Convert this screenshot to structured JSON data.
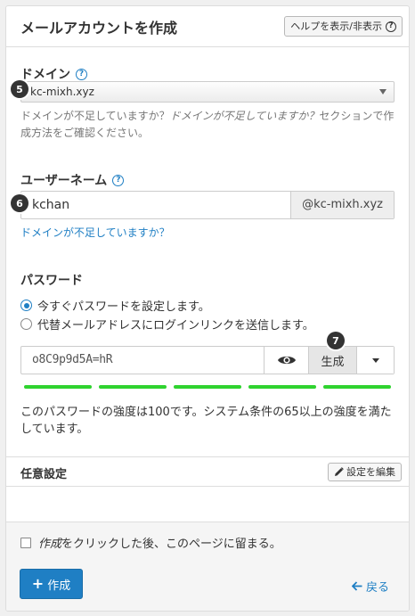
{
  "header": {
    "title": "メールアカウントを作成",
    "help_button": "ヘルプを表示/非表示"
  },
  "domain": {
    "label": "ドメイン",
    "selected": "kc-mixh.xyz",
    "help_part1": "ドメインが不足していますか？",
    "help_italic": "ドメインが不足していますか？",
    "help_part2": "セクションで作成方法をご確認ください。",
    "badge": "5"
  },
  "username": {
    "label": "ユーザーネーム",
    "value": "kchan",
    "suffix": "@kc-mixh.xyz",
    "link": "ドメインが不足していますか？",
    "badge": "6"
  },
  "password": {
    "label": "パスワード",
    "option1": "今すぐパスワードを設定します。",
    "option2": "代替メールアドレスにログインリンクを送信します。",
    "value": "o8C9p9d5A=hR",
    "generate": "生成",
    "badge": "7",
    "strength_segments": 5,
    "strength_text": "このパスワードの強度は100です。システム条件の65以上の強度を満たしています。"
  },
  "optional": {
    "title": "任意設定",
    "edit_button": "設定を編集"
  },
  "footer": {
    "stay_italic": "作成",
    "stay_rest": "をクリックした後、このページに留まる。",
    "create_button": "作成",
    "back_link": "戻る"
  },
  "colors": {
    "accent": "#1f7fc4",
    "strength": "#2fd32f",
    "badge": "#333333"
  }
}
